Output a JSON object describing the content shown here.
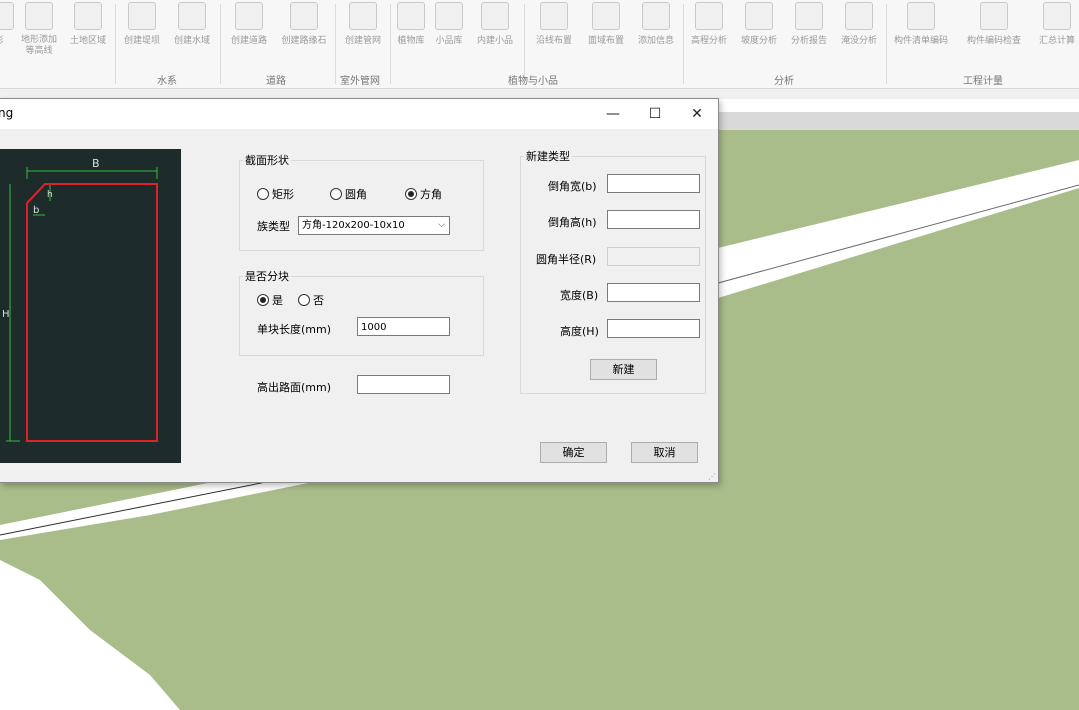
{
  "ribbon": {
    "buttons": [
      {
        "label": "形",
        "icon": "terrain-icon"
      },
      {
        "label": "地形添加",
        "label2": "等高线",
        "icon": "contour-icon"
      },
      {
        "label": "土地区域",
        "icon": "land-area-icon"
      },
      {
        "label": "创建堤坝",
        "icon": "embankment-icon"
      },
      {
        "label": "创建水域",
        "icon": "water-area-icon"
      },
      {
        "label": "创建道路",
        "icon": "road-icon"
      },
      {
        "label": "创建路缘石",
        "icon": "curb-icon"
      },
      {
        "label": "创建管网",
        "icon": "pipe-network-icon"
      },
      {
        "label": "植物库",
        "icon": "plant-library-icon"
      },
      {
        "label": "小品库",
        "icon": "feature-library-icon"
      },
      {
        "label": "内建小品",
        "icon": "in-place-feature-icon"
      },
      {
        "label": "沿线布置",
        "icon": "line-layout-icon"
      },
      {
        "label": "面域布置",
        "icon": "area-layout-icon"
      },
      {
        "label": "添加信息",
        "icon": "add-info-icon"
      },
      {
        "label": "高程分析",
        "icon": "elevation-analysis-icon"
      },
      {
        "label": "坡度分析",
        "icon": "slope-analysis-icon"
      },
      {
        "label": "分析报告",
        "icon": "analysis-report-icon"
      },
      {
        "label": "淹没分析",
        "icon": "flood-analysis-icon"
      },
      {
        "label": "构件清单编码",
        "icon": "component-list-icon"
      },
      {
        "label": "构件编码检查",
        "icon": "code-check-icon"
      },
      {
        "label": "汇总计算",
        "icon": "summary-icon"
      }
    ],
    "groups": [
      "水系",
      "道路",
      "室外管网",
      "植物与小品",
      "分析",
      "工程计量"
    ]
  },
  "dialog": {
    "title": "ng",
    "window_controls": {
      "minimize": "—",
      "maximize": "☐",
      "close": "✕"
    },
    "preview": {
      "dim_b_top": "B",
      "dim_h_corner": "h",
      "dim_b_corner": "b",
      "dim_h_side": "H"
    },
    "section_shape": {
      "title": "截面形状",
      "options": [
        "矩形",
        "圆角",
        "方角"
      ],
      "selected_index": 2,
      "type_label": "族类型",
      "type_value": "方角-120x200-10x10"
    },
    "section_block": {
      "title": "是否分块",
      "options": [
        "是",
        "否"
      ],
      "selected_index": 0,
      "length_label": "单块长度(mm)",
      "length_value": "1000"
    },
    "height_label": "高出路面(mm)",
    "height_value": "",
    "new_type": {
      "title": "新建类型",
      "chamfer_width_label": "倒角宽(b)",
      "chamfer_height_label": "倒角高(h)",
      "fillet_radius_label": "圆角半径(R)",
      "width_label": "宽度(B)",
      "height_label": "高度(H)",
      "new_button": "新建"
    },
    "ok_button": "确定",
    "cancel_button": "取消"
  },
  "colors": {
    "preview_bg": "#1d2b2b",
    "profile_line": "#e0202a",
    "dimension_line": "#2fbf3f",
    "ground": "#a9bd8a",
    "road": "#ffffff"
  }
}
